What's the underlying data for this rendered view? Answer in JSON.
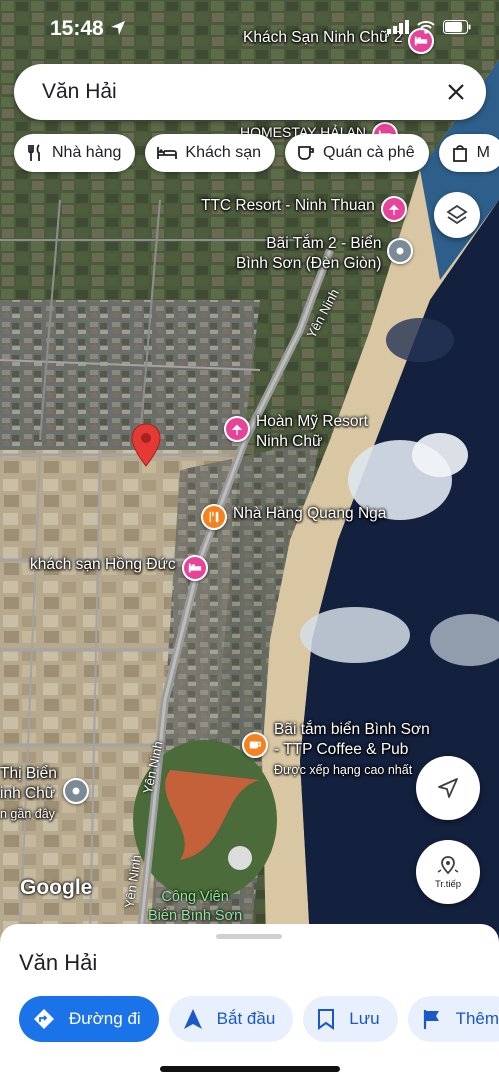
{
  "status_bar": {
    "time": "15:48"
  },
  "search": {
    "query": "Văn Hải"
  },
  "chips": [
    {
      "label": "Nhà hàng",
      "icon": "fork-knife-icon"
    },
    {
      "label": "Khách sạn",
      "icon": "bed-icon"
    },
    {
      "label": "Quán cà phê",
      "icon": "coffee-cup-icon"
    },
    {
      "label": "M",
      "icon": "shopping-bag-icon"
    }
  ],
  "map": {
    "pois": [
      {
        "label": "Khách Sạn Ninh Chữ 2",
        "type": "hotel",
        "color": "#e8439a"
      },
      {
        "label": "HOMESTAY HẢI AN",
        "type": "hotel",
        "color": "#e8439a"
      },
      {
        "label": "TTC Resort - Ninh Thuan",
        "type": "resort",
        "color": "#e8439a"
      },
      {
        "label": "Bãi Tắm 2 - Biển",
        "label2": "Bình Sơn (Đèn Giòn)",
        "type": "place",
        "color": "#7a8a96"
      },
      {
        "label": "Hoàn Mỹ Resort",
        "label2": "Ninh Chữ",
        "type": "resort",
        "color": "#e8439a"
      },
      {
        "label": "Nhà Hàng Quang Nga",
        "type": "restaurant",
        "color": "#f4821f"
      },
      {
        "label": "khách sạn Hồng Đức",
        "type": "hotel",
        "color": "#e8439a"
      },
      {
        "label": "Bãi tắm biển Bình Sơn",
        "label2": "- TTP Coffee & Pub",
        "label3": "Được xếp hạng cao nhất",
        "type": "cafe",
        "color": "#f4821f"
      },
      {
        "label": "Thị Biển",
        "label2": "inh Chữ",
        "label3": "n gần đây",
        "type": "place",
        "color": "#7a8a96"
      }
    ],
    "roads": [
      "Yên Ninh",
      "Yên Ninh",
      "Yên Ninh"
    ],
    "park": {
      "line1": "Công Viên",
      "line2": "Biển Bình Sơn"
    },
    "brand": "Google"
  },
  "buttons": {
    "layers_icon": "layers-icon",
    "my_location_icon": "navigation-arrow-icon",
    "next_label": "Tr.tiếp"
  },
  "sheet": {
    "title": "Văn Hải",
    "actions": [
      {
        "label": "Đường đi",
        "icon": "directions-icon",
        "primary": true
      },
      {
        "label": "Bắt đầu",
        "icon": "navigation-icon"
      },
      {
        "label": "Lưu",
        "icon": "bookmark-icon"
      },
      {
        "label": "Thêm",
        "icon": "flag-icon"
      }
    ]
  },
  "colors": {
    "accent": "#1a73e8",
    "hotel_pin": "#e8439a",
    "food_pin": "#f4821f",
    "dropped_pin": "#e53935"
  }
}
